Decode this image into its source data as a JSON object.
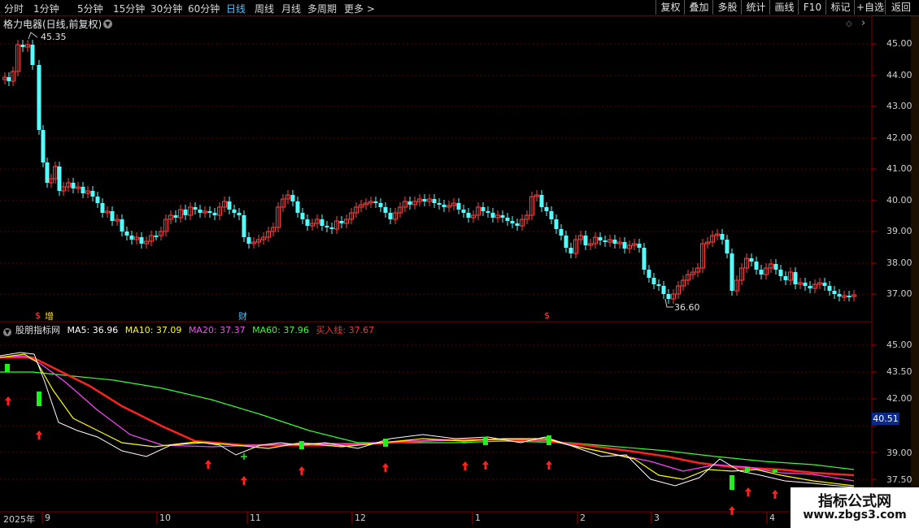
{
  "toolbar": {
    "periods": [
      "分时",
      "1分钟",
      "5分钟",
      "15分钟",
      "30分钟",
      "60分钟",
      "日线",
      "周线",
      "月线",
      "多周期",
      "更多 >"
    ],
    "active_period": "日线",
    "right_buttons": [
      "复权",
      "叠加",
      "多股",
      "统计",
      "画线",
      "F10",
      "标记",
      "+自选",
      "返回"
    ]
  },
  "main_chart": {
    "title": "格力电器(日线,前复权)",
    "high_label": "45.35",
    "low_label": "36.60",
    "y_ticks": [
      "45.00",
      "44.00",
      "43.00",
      "42.00",
      "41.00",
      "40.00",
      "39.00",
      "38.00",
      "37.00"
    ],
    "markers": [
      {
        "text": "$",
        "color": "#ff4040"
      },
      {
        "text": "增",
        "color": "#ffdd00"
      },
      {
        "text": "财",
        "color": "#4fc3ff"
      },
      {
        "text": "$",
        "color": "#ff4040"
      }
    ]
  },
  "indicator": {
    "name": "股朋指标网",
    "ma5": "MA5: 36.96",
    "ma10": "MA10: 37.09",
    "ma20": "MA20: 37.37",
    "ma60": "MA60: 37.96",
    "buy_line": "买入线: 37.67",
    "colors": {
      "ma5": "#ffffff",
      "ma10": "#ffff00",
      "ma20": "#ff44ff",
      "ma60": "#33ff33",
      "buy_line": "#ff3030"
    },
    "y_ticks": [
      "45.00",
      "43.50",
      "42.00",
      "40.50",
      "39.00",
      "37.50"
    ],
    "current_value": "40.51"
  },
  "date_axis": [
    "2025年",
    "9",
    "10",
    "11",
    "12",
    "1",
    "2",
    "3",
    "4"
  ],
  "watermark": {
    "line1": "指标公式网",
    "line2": "www.zbgs3.com"
  }
}
